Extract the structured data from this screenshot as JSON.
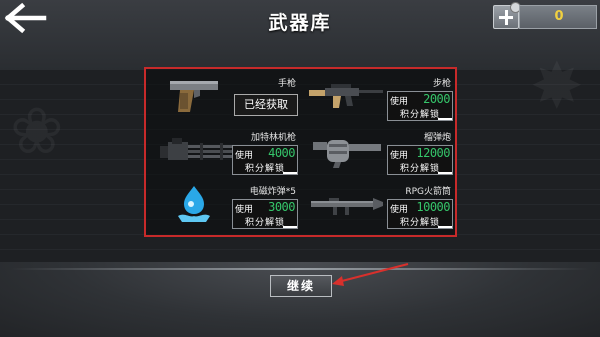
{
  "header": {
    "title": "武器库",
    "coins": "0",
    "back_icon": "back-arrow-icon",
    "add_icon": "plus-icon"
  },
  "weapons": [
    {
      "name": "手枪",
      "status": "已经获取",
      "icon": "pistol-icon"
    },
    {
      "name": "步枪",
      "use_label": "使用",
      "cost": "2000",
      "unlock_label": "积分解锁",
      "icon": "rifle-icon"
    },
    {
      "name": "加特林机枪",
      "use_label": "使用",
      "cost": "4000",
      "unlock_label": "积分解锁",
      "icon": "gatling-icon"
    },
    {
      "name": "榴弹炮",
      "use_label": "使用",
      "cost": "12000",
      "unlock_label": "积分解锁",
      "icon": "grenade-launcher-icon"
    },
    {
      "name": "电磁炸弹*5",
      "use_label": "使用",
      "cost": "3000",
      "unlock_label": "积分解锁",
      "icon": "em-bomb-icon"
    },
    {
      "name": "RPG火箭筒",
      "use_label": "使用",
      "cost": "10000",
      "unlock_label": "积分解锁",
      "icon": "rpg-icon"
    }
  ],
  "footer": {
    "continue_label": "继续"
  },
  "colors": {
    "highlight_border": "#c72a2a",
    "cost_text": "#35c56a",
    "coin_text": "#f0d040"
  }
}
